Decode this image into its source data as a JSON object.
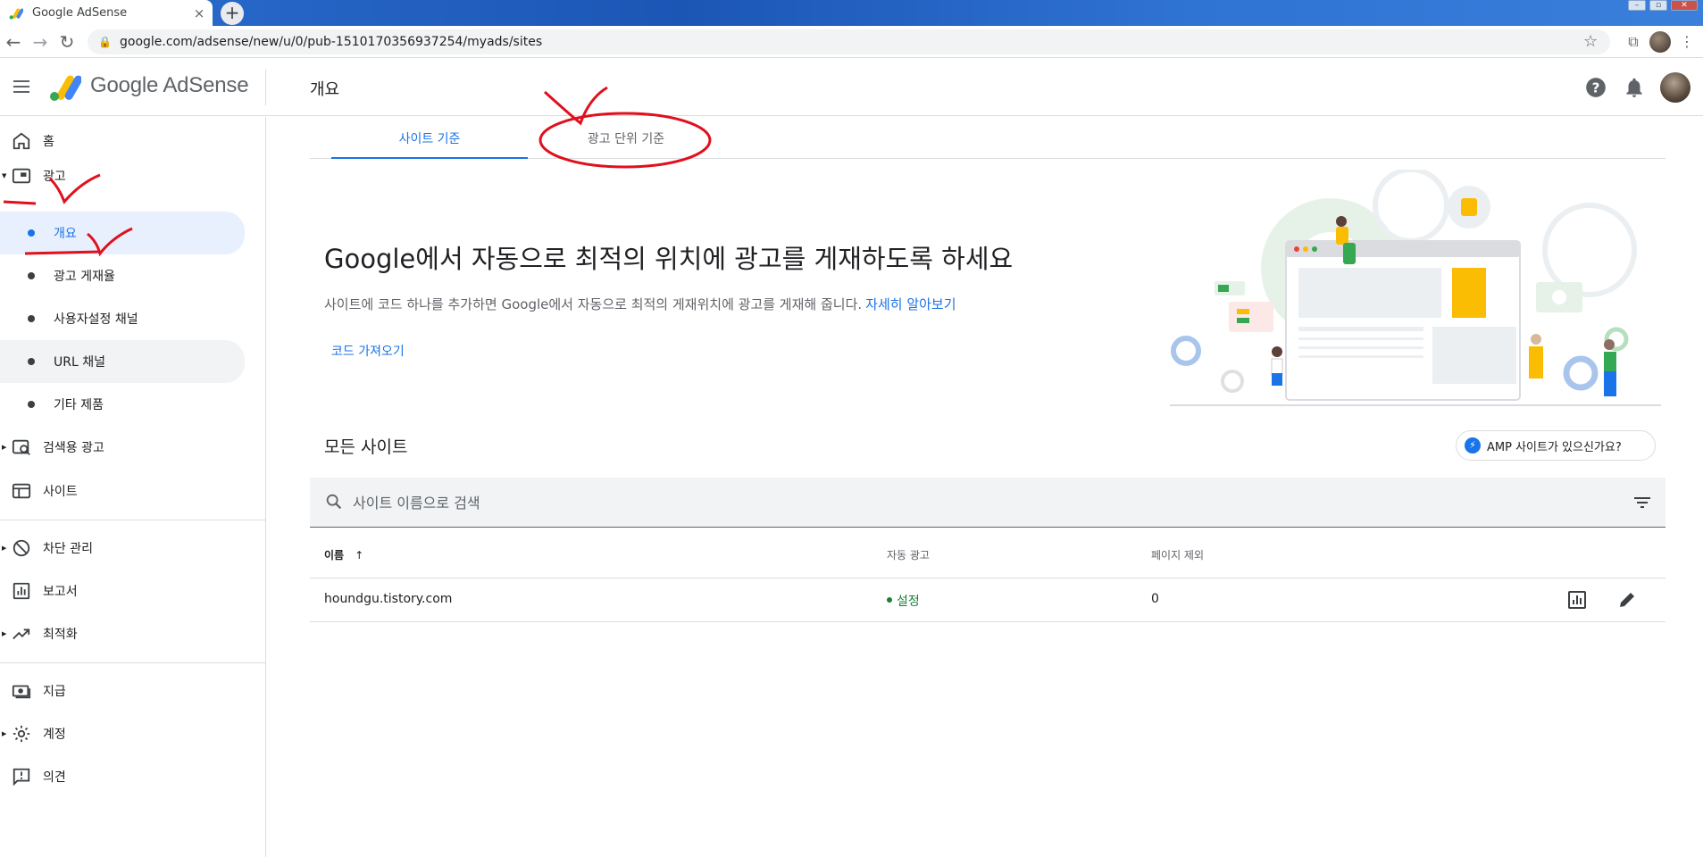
{
  "browser": {
    "tab_title": "Google AdSense",
    "tab_close": "×",
    "new_tab": "+",
    "url": "google.com/adsense/new/u/0/pub-1510170356937254/myads/sites",
    "back_icon": "arrow-left-icon",
    "forward_icon": "arrow-right-icon",
    "reload_icon": "reload-icon",
    "back_glyph": "←",
    "forward_glyph": "→",
    "reload_glyph": "↻",
    "star_glyph": "☆",
    "lock_glyph": "🔒",
    "cast_glyph": "⧉",
    "menu_glyph": "⋮"
  },
  "header": {
    "brand": "Google AdSense",
    "page_title": "개요"
  },
  "sidebar": {
    "home": "홈",
    "ads": "광고",
    "ads_sub": [
      "개요",
      "광고 게재율",
      "사용자설정 채널",
      "URL 채널",
      "기타 제품"
    ],
    "search_ads": "검색용 광고",
    "sites": "사이트",
    "blocking": "차단 관리",
    "reports": "보고서",
    "optimization": "최적화",
    "payments": "지급",
    "account": "계정",
    "feedback": "의견"
  },
  "tabs": [
    {
      "label": "사이트 기준",
      "active": true
    },
    {
      "label": "광고 단위 기준",
      "active": false
    }
  ],
  "hero": {
    "headline": "Google에서 자동으로 최적의 위치에 광고를 게재하도록 하세요",
    "description": "사이트에 코드 하나를 추가하면 Google에서 자동으로 최적의 게재위치에 광고를 게재해 줍니다.",
    "learn_more": "자세히 알아보기",
    "get_code": "코드 가져오기"
  },
  "sites_section": {
    "title": "모든 사이트",
    "amp_button": "AMP 사이트가 있으신가요?",
    "search_placeholder": "사이트 이름으로 검색",
    "columns": {
      "name": "이름",
      "auto_ads": "자동 광고",
      "page_exclusions": "페이지 제외"
    },
    "sort_arrow": "↑",
    "rows": [
      {
        "name": "houndgu.tistory.com",
        "auto_ads": "설정",
        "page_exclusions": "0"
      }
    ]
  },
  "colors": {
    "accent": "#1a73e8",
    "on_status": "#188038",
    "annotation": "#e0101c"
  }
}
